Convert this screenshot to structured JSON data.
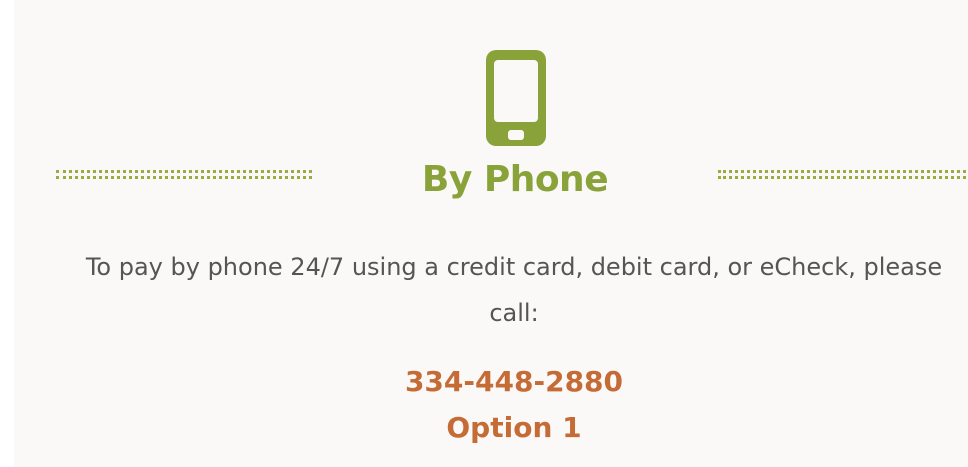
{
  "section": {
    "icon": "smartphone-icon",
    "title": "By Phone",
    "description": "To pay by phone 24/7 using a credit card, debit card, or eCheck, please call:",
    "phone_number": "334-448-2880",
    "option": "Option 1"
  },
  "colors": {
    "icon": "#8aa23a",
    "title": "#8aa23a",
    "divider": "#9aab3f",
    "text": "#555555",
    "accent": "#c56b35",
    "panel_background": "#fbf9f8"
  }
}
